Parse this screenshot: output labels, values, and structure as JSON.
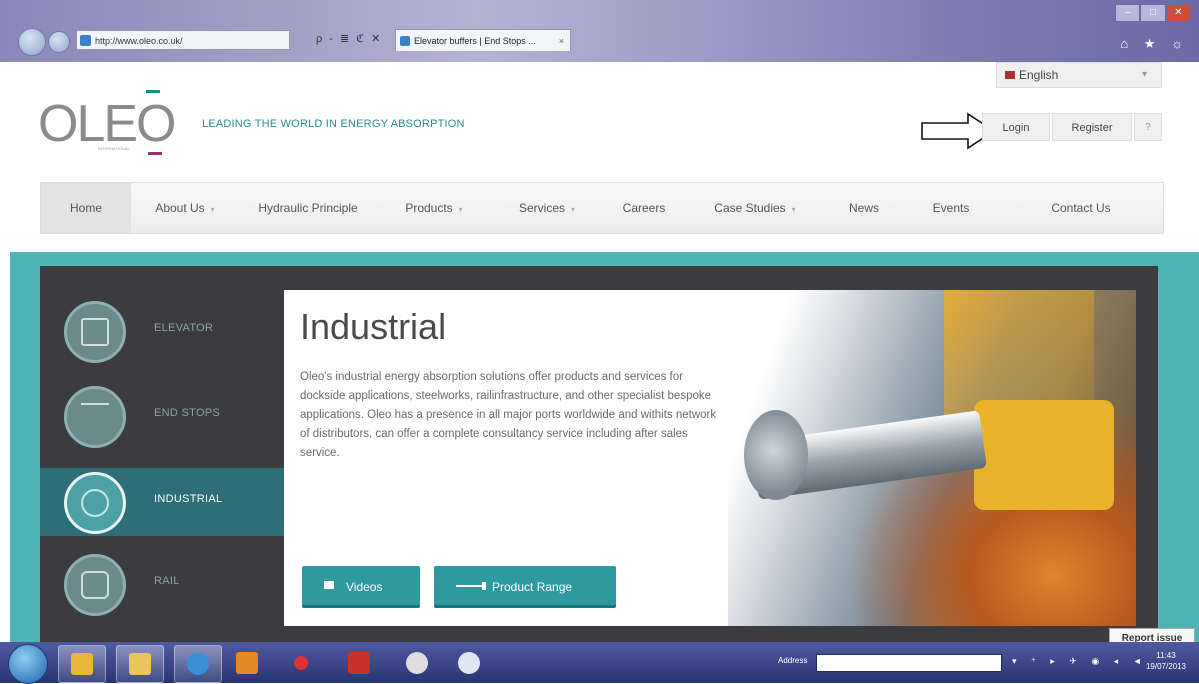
{
  "browser": {
    "address": "http://www.oleo.co.uk/",
    "address_tools": "ρ - ≣ ℭ ✕",
    "tab_title": "Elevator buffers | End Stops ...",
    "tab_close": "×",
    "window_controls": [
      "–",
      "□",
      "✕"
    ],
    "right_icons": "⌂ ★ ☼"
  },
  "header": {
    "language": "English",
    "language_caret": "▾",
    "logo_text": "OLEO",
    "logo_subtext": "INTERNATIONAL",
    "tagline": "LEADING THE WORLD IN ENERGY ABSORPTION",
    "login": "Login",
    "register": "Register",
    "help": "?"
  },
  "nav": {
    "items": [
      {
        "label": "Home",
        "caret": ""
      },
      {
        "label": "About Us",
        "caret": "▾"
      },
      {
        "label": "Hydraulic Principle",
        "caret": ""
      },
      {
        "label": "Products",
        "caret": "▾"
      },
      {
        "label": "Services",
        "caret": "▾"
      },
      {
        "label": "Careers",
        "caret": ""
      },
      {
        "label": "Case Studies",
        "caret": "▾"
      },
      {
        "label": "News",
        "caret": ""
      },
      {
        "label": "Events",
        "caret": ""
      },
      {
        "label": "Contact Us",
        "caret": ""
      }
    ]
  },
  "sidebar": {
    "items": [
      {
        "label": "ELEVATOR",
        "icon": "elevator-icon"
      },
      {
        "label": "END STOPS",
        "icon": "end-stop-icon"
      },
      {
        "label": "INDUSTRIAL",
        "icon": "industrial-icon"
      },
      {
        "label": "RAIL",
        "icon": "rail-icon"
      }
    ]
  },
  "content": {
    "title": "Industrial",
    "description": "Oleo's industrial energy absorption solutions offer products and services for dockside applications, steelworks, railinfrastructure, and other specialist bespoke applications. Oleo has a presence in all major ports worldwide and withits network of distributors, can offer a complete consultancy service including after sales service.",
    "videos_button": "Videos",
    "product_range_button": "Product Range"
  },
  "report_issue": "Report issue",
  "taskbar": {
    "address_label": "Address",
    "tray": "▾ ⁺ ▸ ✈ ◉ ◂ ◄",
    "time": "11:43",
    "date": "19/07/2013"
  },
  "colors": {
    "teal": "#4fb3b6",
    "dark_panel": "#3c3c40",
    "button": "#2e9aa0",
    "tagline": "#2a8b8b"
  }
}
